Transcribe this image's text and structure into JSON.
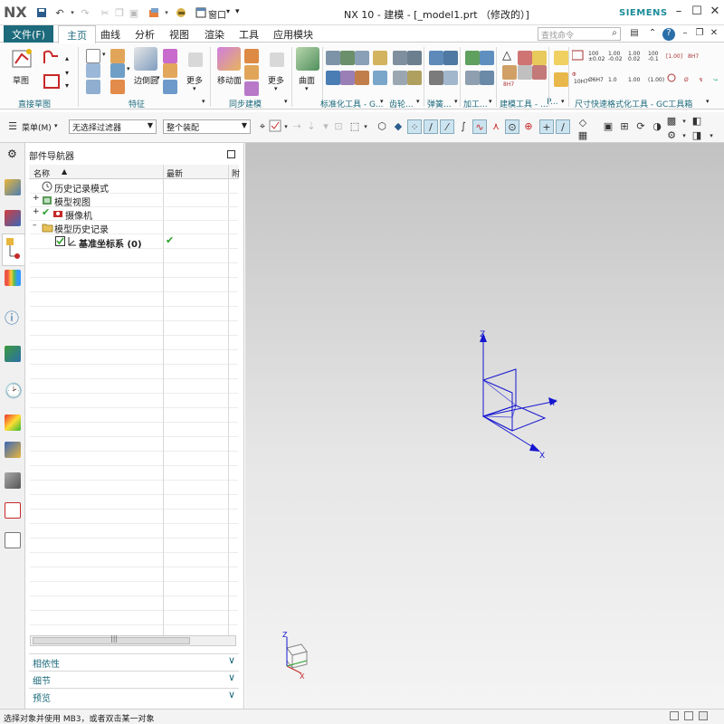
{
  "app": {
    "logo": "NX",
    "title": "NX 10 - 建模 - [_model1.prt （修改的）]",
    "brand": "SIEMENS",
    "window_menu_label": "窗口"
  },
  "tabs": [
    {
      "label": "文件(F)"
    },
    {
      "label": "主页"
    },
    {
      "label": "曲线"
    },
    {
      "label": "分析"
    },
    {
      "label": "视图"
    },
    {
      "label": "渲染"
    },
    {
      "label": "工具"
    },
    {
      "label": "应用模块"
    }
  ],
  "search": {
    "placeholder": "查找命令"
  },
  "ribbon": {
    "sketch_label": "草图",
    "group_direct_sketch": "直接草图",
    "edge_blend_label": "边倒圆",
    "more_label_1": "更多",
    "group_feature": "特征",
    "move_face_label": "移动面",
    "more_label_2": "更多",
    "group_sync": "同步建模",
    "surface_label": "曲面",
    "group_standard": "标准化工具 - G...",
    "group_gear": "齿轮...",
    "group_spring": "弹簧...",
    "group_machining": "加工...",
    "group_modeling_tools": "建模工具 - ...",
    "group_p": "P...",
    "group_dimension": "尺寸快速格式化工具 - GC工具箱"
  },
  "commandbar": {
    "menu_label": "菜单(M)",
    "filter_value": "无选择过滤器",
    "assembly_value": "整个装配"
  },
  "navigator": {
    "title": "部件导航器",
    "columns": {
      "name": "名称",
      "latest": "最新",
      "extra": "附"
    },
    "rows": [
      {
        "label": "历史记录模式"
      },
      {
        "label": "模型视图"
      },
      {
        "label": "摄像机"
      },
      {
        "label": "模型历史记录"
      },
      {
        "label": "基准坐标系 (0)"
      }
    ],
    "panels": [
      "相依性",
      "细节",
      "预览"
    ]
  },
  "viewport": {
    "axis_x": "X",
    "axis_y": "Y",
    "axis_z": "Z"
  },
  "status": {
    "text": "选择对象并使用 MB3，或者双击某一对象"
  },
  "colors": {
    "accent": "#1c6a7c",
    "triad": "#1515d0",
    "check": "#2aa02a"
  }
}
